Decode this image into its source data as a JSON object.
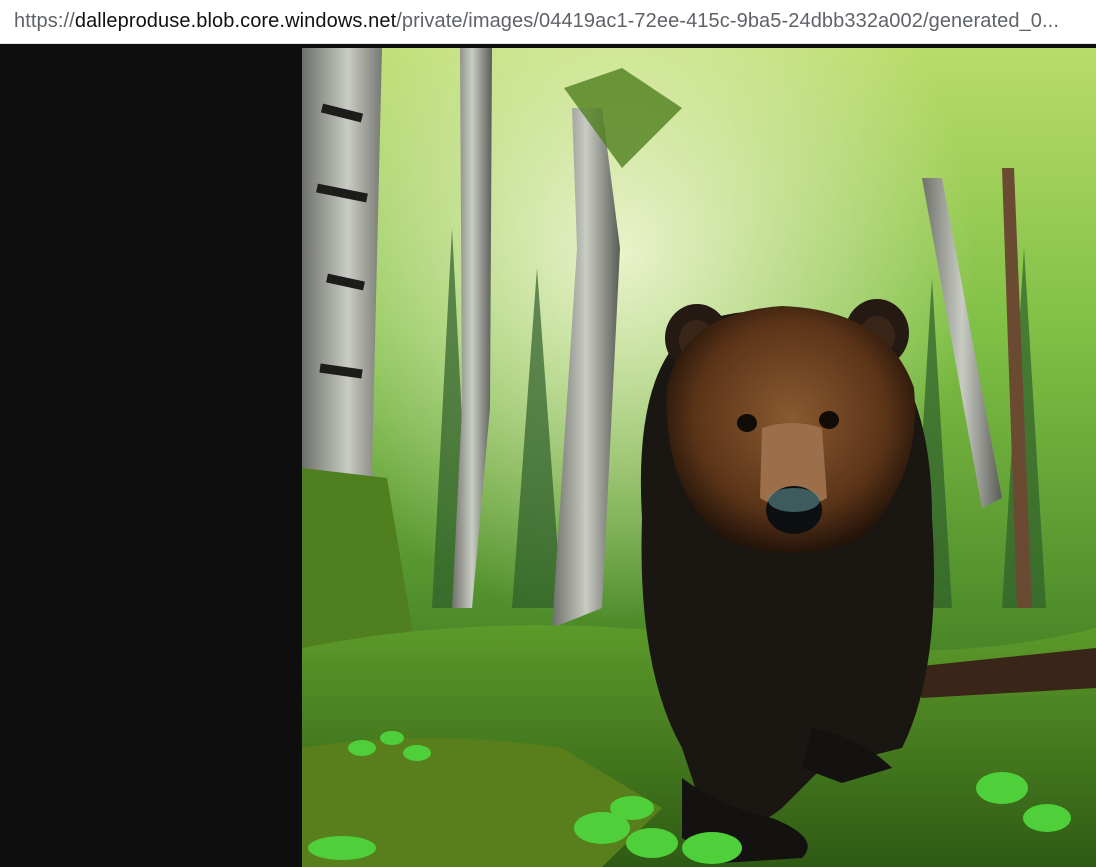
{
  "address_bar": {
    "scheme": "https://",
    "host": "dalleproduse.blob.core.windows.net",
    "path": "/private/images/04419ac1-72ee-415c-9ba5-24dbb332a002/generated_0..."
  },
  "image": {
    "icon": "photo-icon",
    "colors": {
      "canopy": "#6fae3a",
      "moss": "#4f7f1e",
      "bear_fur": "#1a1612",
      "bear_face": "#7a4a26",
      "background": "#0e0e0e"
    }
  }
}
